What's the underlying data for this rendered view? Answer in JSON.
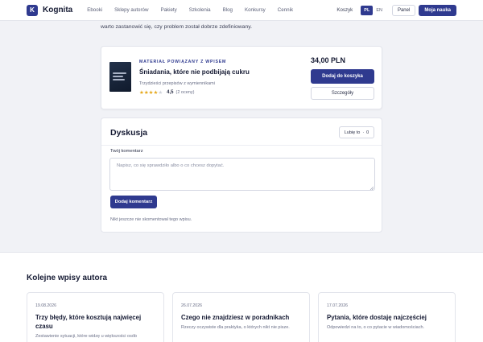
{
  "header": {
    "logo_letter": "K",
    "logo_text": "Kognita",
    "nav": [
      "Ebooki",
      "Sklepy autorów",
      "Pakiety",
      "Szkolenia",
      "Blog",
      "Konkursy",
      "Cennik"
    ],
    "cart": "Koszyk",
    "languages": [
      "PL",
      "EN"
    ],
    "panel": "Panel",
    "primary": "Moja nauka"
  },
  "intro_text": "warto zastanowić się, czy problem został dobrze zdefiniowany.",
  "related_product": {
    "tag": "MATERIAŁ POWIĄZANY Z WPISEM",
    "title": "Śniadania, które nie podbijają cukru",
    "subtitle": "Trzydzieści przepisów z wymiennikami",
    "rating_value": "4,5",
    "rating_count": "(2 oceny)",
    "rating_stars": 4.5,
    "price": "34,00 PLN",
    "add_to_cart": "Dodaj do koszyka",
    "details": "Szczegóły"
  },
  "discussion": {
    "title": "Dyskusja",
    "sort_label": "Lubię to",
    "sort_count": "0",
    "comment_label": "Twój komentarz",
    "comment_placeholder": "Napisz, co się sprawdziło albo o co chcesz dopytać.",
    "submit": "Dodaj komentarz",
    "empty_state": "Nikt jeszcze nie skomentował tego wpisu."
  },
  "more_posts": {
    "title": "Kolejne wpisy autora",
    "posts": [
      {
        "date": "19.08.2026",
        "title": "Trzy błędy, które kosztują najwięcej czasu",
        "excerpt": "Zestawienie sytuacji, które widzę u większości osób"
      },
      {
        "date": "26.07.2026",
        "title": "Czego nie znajdziesz w poradnikach",
        "excerpt": "Rzeczy oczywiste dla praktyka, o których nikt nie pisze."
      },
      {
        "date": "17.07.2026",
        "title": "Pytania, które dostaję najczęściej",
        "excerpt": "Odpowiedzi na to, o co pytacie w wiadomościach."
      }
    ]
  },
  "colors": {
    "brand": "#2f3a8f",
    "star": "#e5a81b",
    "background": "#f1f2f6"
  }
}
